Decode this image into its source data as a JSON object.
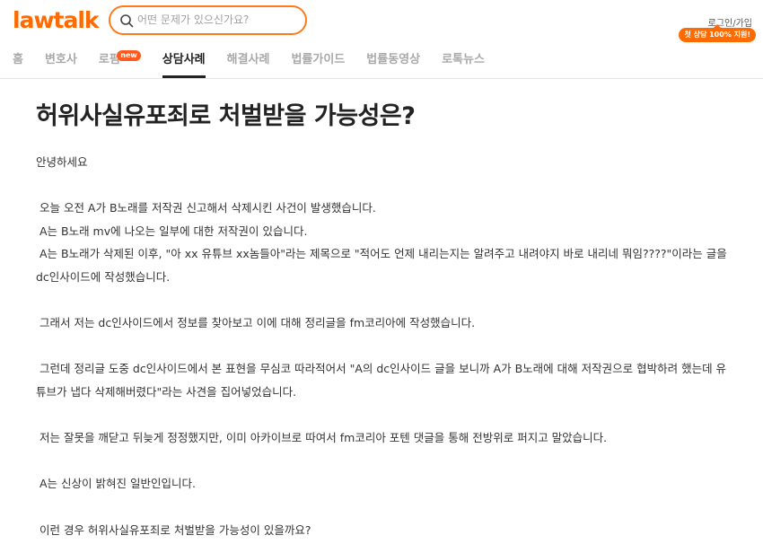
{
  "header": {
    "logo": "lawtalk",
    "search_placeholder": "어떤 문제가 있으신가요?",
    "login_label": "로그인/가입",
    "promo_badge": "첫 상담 100% 지원!"
  },
  "nav": {
    "items": [
      {
        "label": "홈"
      },
      {
        "label": "변호사"
      },
      {
        "label": "로펌",
        "badge": "new"
      },
      {
        "label": "상담사례"
      },
      {
        "label": "해결사례"
      },
      {
        "label": "법률가이드"
      },
      {
        "label": "법률동영상"
      },
      {
        "label": "로톡뉴스"
      }
    ],
    "active_index": 3
  },
  "post": {
    "title": "허위사실유포죄로 처벌받을 가능성은?",
    "lines": [
      "안녕하세요",
      "",
      " 오늘 오전 A가 B노래를 저작권 신고해서 삭제시킨 사건이 발생했습니다.",
      " A는 B노래 mv에 나오는 일부에 대한 저작권이 있습니다.",
      " A는 B노래가 삭제된 이후, \"아 xx 유튜브 xx놈들아\"라는 제목으로 \"적어도 언제 내리는지는 알려주고 내려야지 바로 내리네 뭐임????\"이라는 글을",
      "dc인사이드에 작성했습니다.",
      "",
      " 그래서 저는 dc인사이드에서 정보를 찾아보고 이에 대해 정리글을 fm코리아에 작성했습니다.",
      "",
      " 그런데 정리글 도중 dc인사이드에서 본 표현을 무심코 따라적어서 \"A의 dc인사이드 글을 보니까 A가 B노래에 대해 저작권으로 협박하려 했는데 유",
      "튜브가 냅다 삭제해버렸다\"라는 사견을 집어넣었습니다.",
      "",
      " 저는 잘못을 깨닫고 뒤늦게 정정했지만, 이미 아카이브로 따여서 fm코리아 포텐 댓글을 통해 전방위로 퍼지고 말았습니다.",
      "",
      " A는 신상이 밝혀진 일반인입니다.",
      "",
      " 이런 경우 허위사실유포죄로 처벌받을 가능성이 있을까요?"
    ]
  },
  "colors": {
    "brand": "#ff6b00",
    "badge": "#ff5a1f",
    "text": "#333333",
    "nav_inactive": "#a9a9a9"
  }
}
